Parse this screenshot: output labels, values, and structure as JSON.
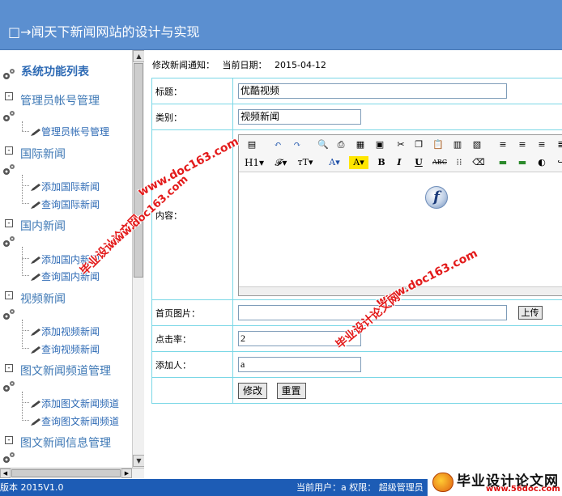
{
  "banner": {
    "title": "□→闻天下新闻网站的设计与实现"
  },
  "sidebar": {
    "title": "系统功能列表",
    "sections": [
      {
        "label": "管理员帐号管理",
        "items": [
          "管理员帐号管理"
        ]
      },
      {
        "label": "国际新闻",
        "items": [
          "添加国际新闻",
          "查询国际新闻"
        ]
      },
      {
        "label": "国内新闻",
        "items": [
          "添加国内新闻",
          "查询国内新闻"
        ]
      },
      {
        "label": "视频新闻",
        "items": [
          "添加视频新闻",
          "查询视频新闻"
        ]
      },
      {
        "label": "图文新闻频道管理",
        "items": [
          "添加图文新闻频道",
          "查询图文新闻频道"
        ]
      },
      {
        "label": "图文新闻信息管理",
        "items": []
      }
    ]
  },
  "notice": {
    "label": "修改新闻通知：",
    "date_label": "当前日期：",
    "date": "2015-04-12"
  },
  "form": {
    "title_label": "标题：",
    "title_value": "优酷视频",
    "category_label": "类别：",
    "category_value": "视频新闻",
    "content_label": "内容：",
    "image_label": "首页图片：",
    "image_value": "",
    "upload_button": "上传",
    "clicks_label": "点击率：",
    "clicks_value": "2",
    "adder_label": "添加人：",
    "adder_value": "a",
    "submit_button": "修改",
    "reset_button": "重置"
  },
  "editor": {
    "toolbar_row1": [
      "source-icon",
      "undo-icon",
      "redo-icon",
      "preview-icon",
      "print-icon",
      "template-icon",
      "page-icon",
      "cut-icon",
      "copy-icon",
      "paste-icon",
      "paste-text-icon",
      "paste-word-icon",
      "align-left-icon",
      "align-center-icon",
      "align-right-icon"
    ],
    "toolbar_row2": [
      "H1▾",
      "𝓕▾",
      "тT▾",
      "A▾",
      "A▾",
      "B",
      "I",
      "U",
      "ABC",
      "",
      ""
    ],
    "flash_letter": "f",
    "resize_glyph": "⇕"
  },
  "status": {
    "version": "版本 2015V1.0",
    "user": "当前用户：a 权限： 超级管理员"
  },
  "watermarks": {
    "site1": "www.doc163.com",
    "site2": "毕业设计论文网",
    "site3": "www.doc163.com",
    "site4": "毕业设计论文网",
    "site5": "www.doc163.com"
  },
  "logo": {
    "name": "毕业设计论文网",
    "url": "www.56doc.com"
  },
  "colors": {
    "banner": "#5b8fd0",
    "link": "#2f6bb5",
    "border": "#7ad7e6",
    "status": "#1d5cb5",
    "watermark": "#e31b1b"
  }
}
